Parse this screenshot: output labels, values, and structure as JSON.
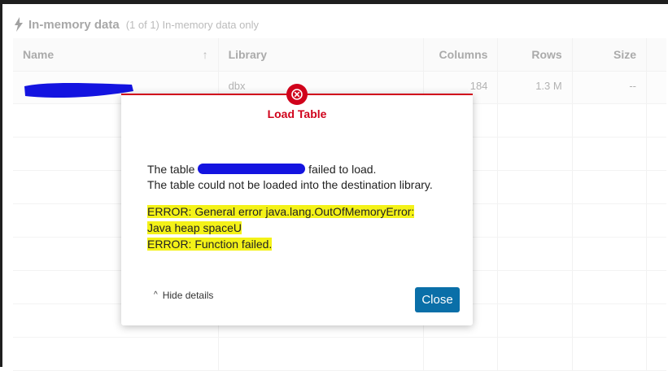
{
  "panel": {
    "title": "In-memory data",
    "subtitle": "(1 of 1) In-memory data only",
    "icon": "lightning-bolt-icon"
  },
  "table": {
    "columns": [
      "Name",
      "Library",
      "Columns",
      "Rows",
      "Size"
    ],
    "sort_icon": "arrow-up-icon",
    "rows": [
      {
        "name": "",
        "library": "dbx",
        "columns": "184",
        "rows": "1.3 M",
        "size": "--"
      }
    ]
  },
  "dialog": {
    "title": "Load Table",
    "icon": "error-circle-icon",
    "message_prefix": "The table",
    "message_suffix": "failed to load.",
    "message_line2": "The table could not be loaded into the destination library.",
    "error_lines": [
      "ERROR: General error java.lang.OutOfMemoryError:",
      "Java heap spaceU",
      "ERROR: Function failed."
    ],
    "hide_details_label": "Hide details",
    "close_label": "Close",
    "colors": {
      "error": "#d0021b",
      "primary": "#0a6fa8",
      "highlight": "#f4f218",
      "redaction": "#1414e0"
    }
  }
}
